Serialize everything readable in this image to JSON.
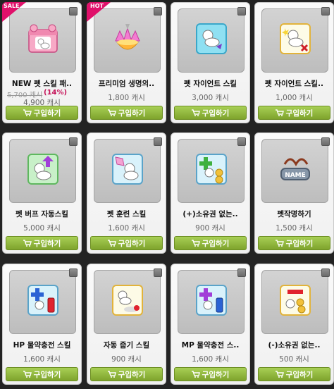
{
  "items": [
    {
      "name": "NEW 펫 스킬 패..",
      "old_price": "5,700 캐시",
      "discount": "(14%)",
      "price": "4,900 캐시",
      "buy_label": "구입하기",
      "ribbon": "SALE",
      "ribbon_color": "#e0106a",
      "icon": "pet-skill-pack-icon"
    },
    {
      "name": "프리미엄 생명의..",
      "price": "1,800 캐시",
      "buy_label": "구입하기",
      "ribbon": "HOT",
      "ribbon_color": "#e0106a",
      "icon": "premium-water-of-life-icon"
    },
    {
      "name": "펫 자이언트 스킬",
      "price": "3,000 캐시",
      "buy_label": "구입하기",
      "icon": "pet-giant-skill-icon"
    },
    {
      "name": "펫 자이언트 스킬..",
      "price": "1,000 캐시",
      "buy_label": "구입하기",
      "icon": "pet-giant-skill-remove-icon"
    },
    {
      "name": "펫 버프 자동스킬",
      "price": "5,000 캐시",
      "buy_label": "구입하기",
      "icon": "pet-buff-auto-skill-icon"
    },
    {
      "name": "펫 훈련 스킬",
      "price": "1,600 캐시",
      "buy_label": "구입하기",
      "icon": "pet-training-skill-icon"
    },
    {
      "name": "(+)소유권 없는..",
      "price": "900 캐시",
      "buy_label": "구입하기",
      "icon": "ownership-plus-icon"
    },
    {
      "name": "펫작명하기",
      "price": "1,500 캐시",
      "buy_label": "구입하기",
      "icon": "pet-name-tag-icon"
    },
    {
      "name": "HP 물약충전 스킬",
      "price": "1,600 캐시",
      "buy_label": "구입하기",
      "icon": "hp-potion-skill-icon"
    },
    {
      "name": "자동 줍기 스킬",
      "price": "900 캐시",
      "buy_label": "구입하기",
      "icon": "auto-loot-skill-icon"
    },
    {
      "name": "MP 물약충전 스..",
      "price": "1,600 캐시",
      "buy_label": "구입하기",
      "icon": "mp-potion-skill-icon"
    },
    {
      "name": "(-)소유권 없는..",
      "price": "500 캐시",
      "buy_label": "구입하기",
      "icon": "ownership-minus-icon"
    }
  ]
}
